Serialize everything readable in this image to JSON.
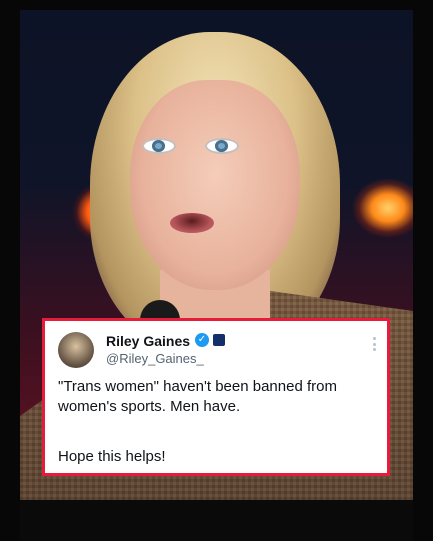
{
  "tweet": {
    "display_name": "Riley Gaines",
    "handle": "@Riley_Gaines_",
    "text": "\"Trans women\" haven't been banned from women's sports. Men have.",
    "closing": "Hope this helps!",
    "verified_icon": "verified-check-icon",
    "affiliation_icon": "affiliation-badge-icon",
    "menu_icon": "more-vertical-icon"
  },
  "colors": {
    "card_border": "#e51d3b",
    "verified_blue": "#1d9bf0",
    "text_primary": "#0f1419",
    "text_secondary": "#536471"
  }
}
